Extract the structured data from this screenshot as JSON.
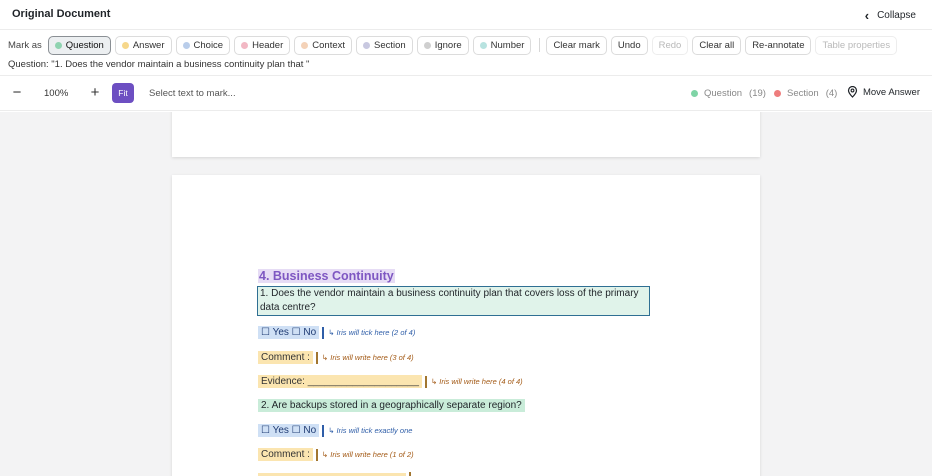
{
  "header": {
    "title": "Original Document",
    "collapse_label": "Collapse"
  },
  "markbar": {
    "label": "Mark as",
    "types": [
      {
        "label": "Question",
        "color": "#8fd3b0",
        "active": true
      },
      {
        "label": "Answer",
        "color": "#f6d78b"
      },
      {
        "label": "Choice",
        "color": "#b9cdea"
      },
      {
        "label": "Header",
        "color": "#f2b8c4"
      },
      {
        "label": "Context",
        "color": "#f4d2b8"
      },
      {
        "label": "Section",
        "color": "#c8c8e0"
      },
      {
        "label": "Ignore",
        "color": "#cfcfcf"
      },
      {
        "label": "Number",
        "color": "#b8e3e0"
      }
    ],
    "actions": [
      {
        "label": "Clear mark"
      },
      {
        "label": "Undo"
      },
      {
        "label": "Redo",
        "disabled": true
      },
      {
        "label": "Clear all"
      },
      {
        "label": "Re-annotate"
      },
      {
        "label": "Table properties",
        "disabled": true
      }
    ]
  },
  "question_preview": "Question: \"1. Does the vendor maintain a business continuity plan that \"",
  "zoombar": {
    "zoom_out": "−",
    "zoom_level": "100%",
    "zoom_in": "+",
    "fit_label": "Fit",
    "hint": "Select text to mark...",
    "legend": [
      {
        "label": "Question",
        "count": "(19)",
        "color": "#7fd4a6"
      },
      {
        "label": "Section",
        "count": "(4)",
        "color": "#ee7d7d"
      }
    ],
    "move_answer_label": "Move Answer"
  },
  "document": {
    "section_title": "4. Business Continuity",
    "q1": "1. Does the vendor maintain a business continuity plan that covers loss of the primary data centre?",
    "q1_choices": "☐ Yes    ☐ No",
    "q1_choice_note": "↳ Iris will tick here (2 of 4)",
    "q1_comment": "Comment :",
    "q1_comment_note": "↳ Iris will write here (3 of 4)",
    "q1_evidence": "Evidence: ____________________",
    "q1_evidence_note": "↳ Iris will write here (4 of 4)",
    "q2": "2. Are backups stored in a geographically separate region?",
    "q2_choices": "☐ Yes    ☐ No",
    "q2_choice_note": "↳ Iris will tick exactly one",
    "q2_comment": "Comment :",
    "q2_comment_note": "↳ Iris will write here (1 of 2)"
  }
}
